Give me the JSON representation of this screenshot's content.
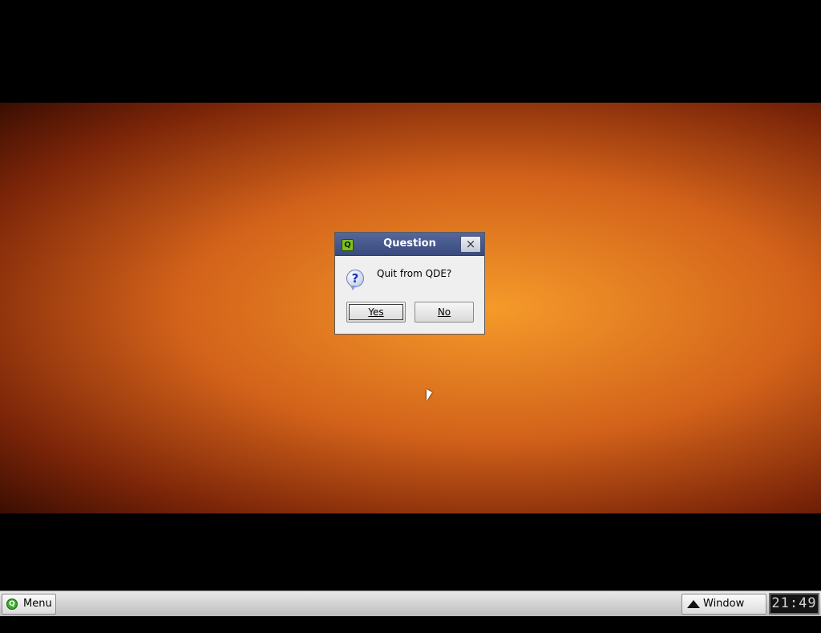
{
  "dialog": {
    "title": "Question",
    "app_icon_glyph": "Q",
    "close_glyph": "×",
    "icon": "question-icon",
    "message": "Quit from QDE?",
    "yes_label": "Yes",
    "no_label": "No"
  },
  "taskbar": {
    "menu_label": "Menu",
    "menu_logo_glyph": "Q",
    "window_list_label": "Window List",
    "window_list_icon": "up-arrow-icon",
    "clock": "21:49"
  },
  "colors": {
    "titlebar": "#3a4a7e",
    "dialog_bg": "#efefef",
    "taskbar": "#d2d2d2",
    "app_icon": "#7ec21f"
  }
}
